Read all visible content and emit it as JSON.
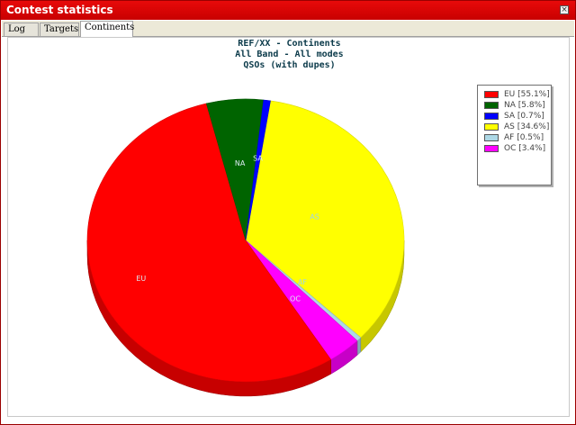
{
  "window": {
    "title": "Contest statistics",
    "close_glyph": "×",
    "titlebar_color": "#d90000"
  },
  "tabs": [
    {
      "label": "Log",
      "active": false
    },
    {
      "label": "Targets",
      "active": false
    },
    {
      "label": "Continents",
      "active": true
    }
  ],
  "chart": {
    "title_lines": [
      "REF/XX - Continents",
      "All Band - All modes",
      "QSOs (with dupes)"
    ]
  },
  "chart_data": {
    "type": "pie",
    "title": "REF/XX - Continents / All Band - All modes / QSOs (with dupes)",
    "legend_position": "top-right",
    "slices": [
      {
        "name": "EU",
        "label": "EU [55.1%]",
        "value": 55.1,
        "color": "#ff0000"
      },
      {
        "name": "NA",
        "label": "NA [5.8%]",
        "value": 5.8,
        "color": "#006400"
      },
      {
        "name": "SA",
        "label": "SA [0.7%]",
        "value": 0.7,
        "color": "#0000ff"
      },
      {
        "name": "AS",
        "label": "AS [34.6%]",
        "value": 34.6,
        "color": "#ffff00"
      },
      {
        "name": "AF",
        "label": "AF [0.5%]",
        "value": 0.5,
        "color": "#add8e6"
      },
      {
        "name": "OC",
        "label": "OC [3.4%]",
        "value": 3.4,
        "color": "#ff00ff"
      }
    ]
  }
}
